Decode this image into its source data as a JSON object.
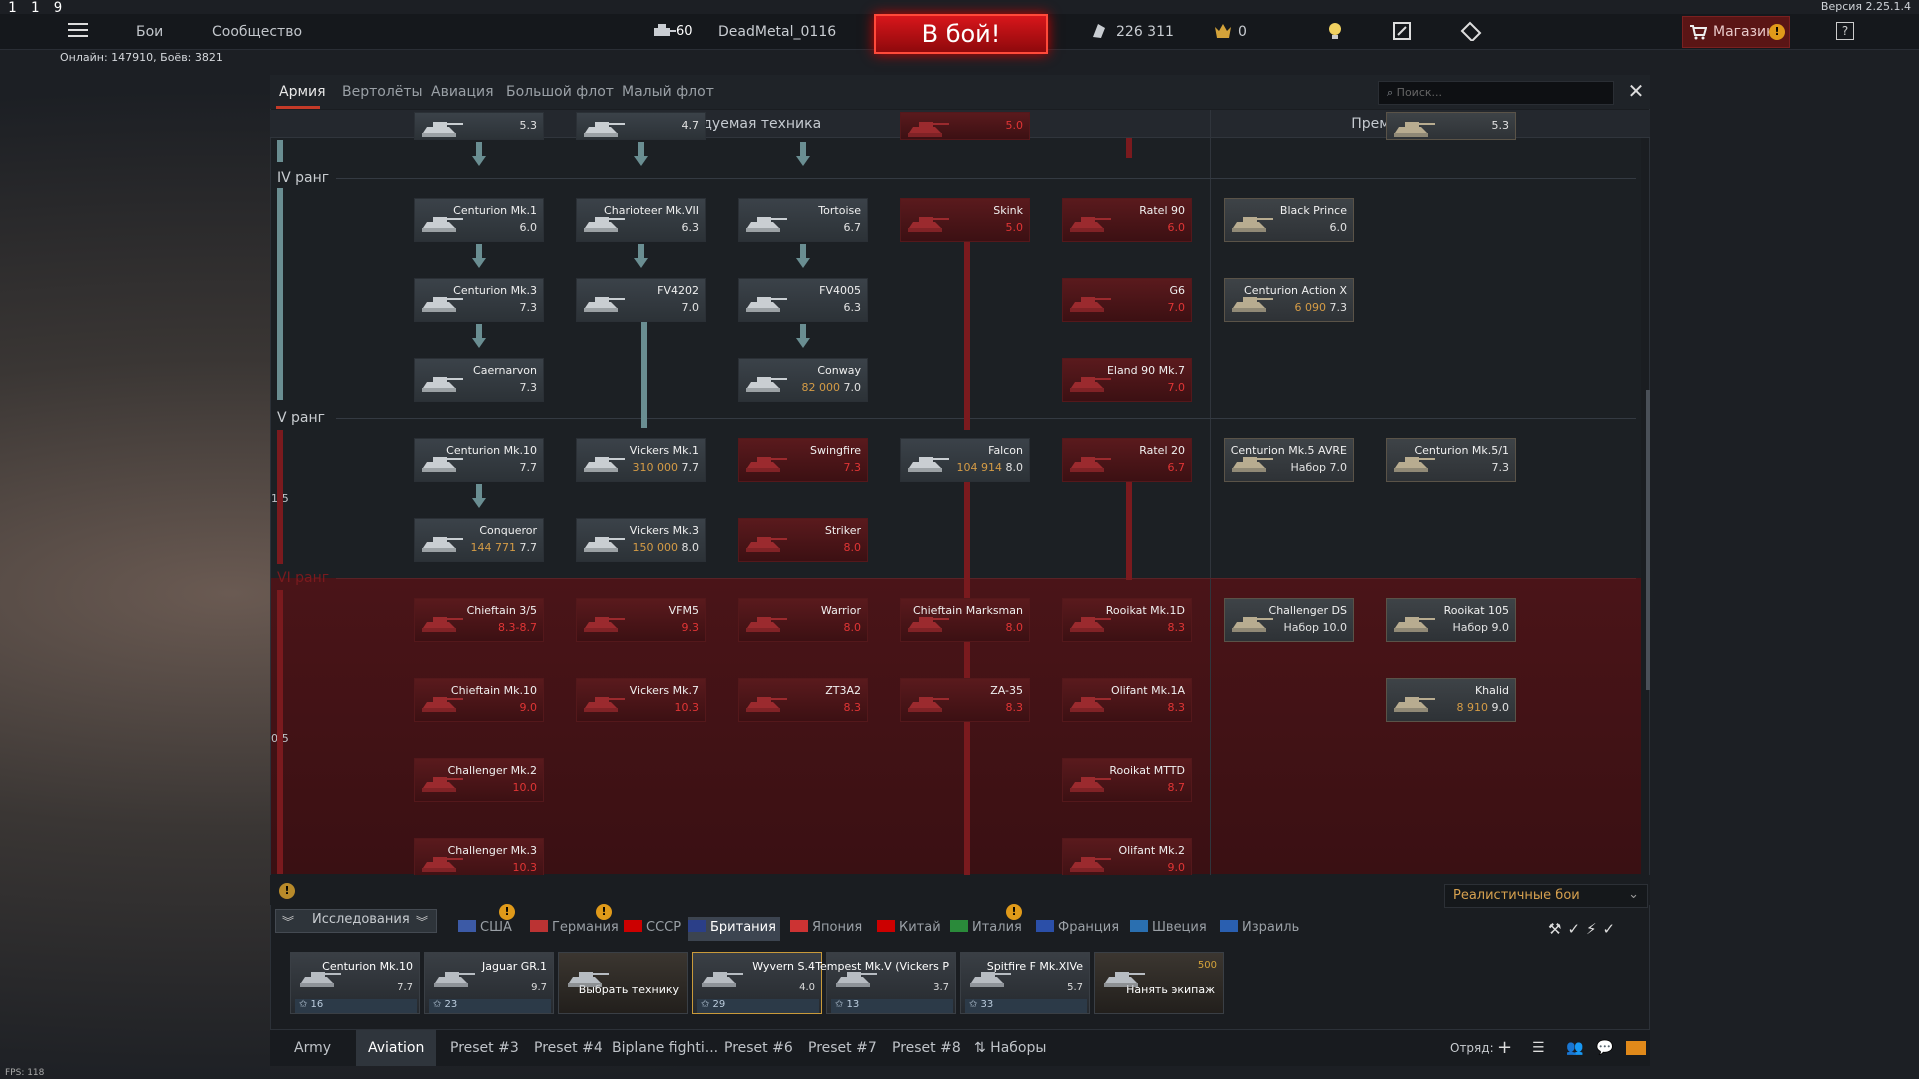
{
  "top": {
    "fps_counter": "1 1 9",
    "version": "Версия 2.25.1.4",
    "menu": [
      "Бои",
      "Сообщество"
    ],
    "online": "Онлайн: 147910, Боёв: 3821",
    "level": "60",
    "player": "DeadMetal_0116",
    "battle_button": "В бой!",
    "silver_lions": "226 311",
    "golden_eagles": "0",
    "shop": "Магазин"
  },
  "tabs": [
    "Армия",
    "Вертолёты",
    "Авиация",
    "Большой флот",
    "Малый флот"
  ],
  "search_placeholder": "Поиск...",
  "headers": {
    "researchable": "Исследуемая техника",
    "premium": "Премиумная техника"
  },
  "ranks": {
    "iv": "IV ранг",
    "v": "V ранг",
    "vi": "VI ранг"
  },
  "fractions": [
    "1/5",
    "0/5"
  ],
  "cards": [
    {
      "name": "",
      "br": "5.3",
      "state": "res"
    },
    {
      "name": "",
      "br": "4.7",
      "state": "res"
    },
    {
      "name": "",
      "br": "5.0",
      "state": "loc"
    },
    {
      "name": "",
      "br": "5.3",
      "state": "prem"
    },
    {
      "name": "Centurion Mk.1",
      "br": "6.0",
      "state": "res"
    },
    {
      "name": "Charioteer Mk.VII",
      "br": "6.3",
      "state": "res"
    },
    {
      "name": "Tortoise",
      "br": "6.7",
      "state": "res"
    },
    {
      "name": "Skink",
      "br": "5.0",
      "state": "loc"
    },
    {
      "name": "Ratel 90",
      "br": "6.0",
      "state": "loc"
    },
    {
      "name": "Black Prince",
      "br": "6.0",
      "state": "prem"
    },
    {
      "name": "Centurion Mk.3",
      "br": "7.3",
      "state": "res"
    },
    {
      "name": "FV4202",
      "br": "7.0",
      "state": "res"
    },
    {
      "name": "FV4005",
      "br": "6.3",
      "state": "res"
    },
    {
      "name": "G6",
      "br": "7.0",
      "state": "loc"
    },
    {
      "name": "Centurion Action X",
      "br": "7.3",
      "cost": "6 090",
      "state": "prem"
    },
    {
      "name": "Caernarvon",
      "br": "7.3",
      "state": "res"
    },
    {
      "name": "Conway",
      "br": "7.0",
      "cost": "82 000",
      "state": "res"
    },
    {
      "name": "Eland 90 Mk.7",
      "br": "7.0",
      "state": "loc"
    },
    {
      "name": "Centurion Mk.10",
      "br": "7.7",
      "state": "res"
    },
    {
      "name": "Vickers Mk.1",
      "br": "7.7",
      "cost": "310 000",
      "state": "res"
    },
    {
      "name": "Swingfire",
      "br": "7.3",
      "state": "loc"
    },
    {
      "name": "Falcon",
      "br": "8.0",
      "cost": "104 914",
      "state": "res"
    },
    {
      "name": "Ratel 20",
      "br": "6.7",
      "state": "loc"
    },
    {
      "name": "Centurion Mk.5 AVRE",
      "br": "Набор 7.0",
      "state": "prem"
    },
    {
      "name": "Centurion Mk.5/1",
      "br": "7.3",
      "state": "prem"
    },
    {
      "name": "Conqueror",
      "br": "7.7",
      "cost": "144 771",
      "state": "res"
    },
    {
      "name": "Vickers Mk.3",
      "br": "8.0",
      "cost": "150 000",
      "state": "res"
    },
    {
      "name": "Striker",
      "br": "8.0",
      "state": "loc"
    },
    {
      "name": "Chieftain 3/5",
      "br": "8.3-8.7",
      "state": "loc"
    },
    {
      "name": "VFM5",
      "br": "9.3",
      "state": "loc"
    },
    {
      "name": "Warrior",
      "br": "8.0",
      "state": "loc"
    },
    {
      "name": "Chieftain Marksman",
      "br": "8.0",
      "state": "loc"
    },
    {
      "name": "Rooikat Mk.1D",
      "br": "8.3",
      "state": "loc"
    },
    {
      "name": "Challenger DS",
      "br": "Набор 10.0",
      "state": "prem"
    },
    {
      "name": "Rooikat 105",
      "br": "Набор 9.0",
      "state": "prem"
    },
    {
      "name": "Chieftain Mk.10",
      "br": "9.0",
      "state": "loc"
    },
    {
      "name": "Vickers Mk.7",
      "br": "10.3",
      "state": "loc"
    },
    {
      "name": "ZT3A2",
      "br": "8.3",
      "state": "loc"
    },
    {
      "name": "ZA-35",
      "br": "8.3",
      "state": "loc"
    },
    {
      "name": "Olifant Mk.1A",
      "br": "8.3",
      "state": "loc"
    },
    {
      "name": "Khalid",
      "br": "9.0",
      "cost": "8 910",
      "state": "prem"
    },
    {
      "name": "Challenger Mk.2",
      "br": "10.0",
      "state": "loc"
    },
    {
      "name": "Rooikat MTTD",
      "br": "8.7",
      "state": "loc"
    },
    {
      "name": "Challenger Mk.3",
      "br": "10.3",
      "state": "loc"
    },
    {
      "name": "Olifant Mk.2",
      "br": "9.0",
      "state": "loc"
    }
  ],
  "game_mode": "Реалистичные бои",
  "research_button": "Исследования",
  "nations": [
    "США",
    "Германия",
    "СССР",
    "Британия",
    "Япония",
    "Китай",
    "Италия",
    "Франция",
    "Швеция",
    "Израиль"
  ],
  "active_nation": "Британия",
  "slots": [
    {
      "name": "Centurion Mk.10",
      "br": "7.7",
      "count": "16"
    },
    {
      "name": "Jaguar GR.1",
      "br": "9.7",
      "count": "23"
    },
    {
      "name": "Выбрать технику",
      "br": "",
      "count": ""
    },
    {
      "name": "Wyvern S.4",
      "br": "4.0",
      "count": "29"
    },
    {
      "name": "Tempest Mk.V (Vickers P",
      "br": "3.7",
      "count": "13"
    },
    {
      "name": "Spitfire F Mk.XIVe",
      "br": "5.7",
      "count": "33"
    },
    {
      "name": "Нанять экипаж",
      "br": "500",
      "count": ""
    }
  ],
  "presets": [
    "Army",
    "Aviation",
    "Preset #3",
    "Preset #4",
    "Biplane fighti...",
    "Preset #6",
    "Preset #7",
    "Preset #8",
    "Наборы"
  ],
  "active_preset": "Aviation",
  "squad": "Отряд:",
  "fps_footer": "FPS: 118"
}
